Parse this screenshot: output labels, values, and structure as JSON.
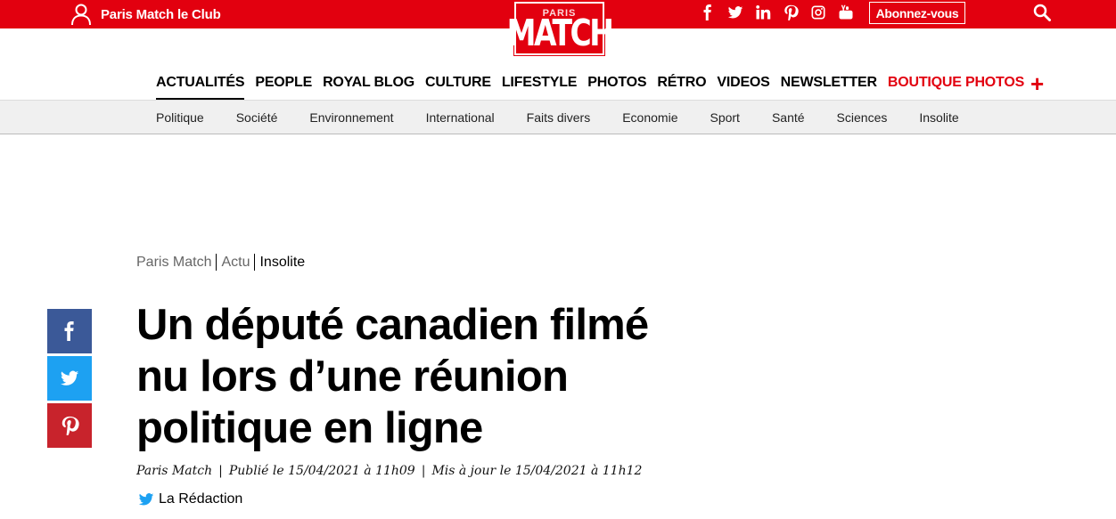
{
  "topbar": {
    "club_label": "Paris Match le Club",
    "logo_small": "PARIS",
    "logo_big": "MATCH",
    "subscribe_label": "Abonnez-vous",
    "social_icons": [
      "facebook-icon",
      "twitter-icon",
      "linkedin-icon",
      "pinterest-icon",
      "instagram-icon",
      "youtube-icon"
    ],
    "brand_color": "#e2000f"
  },
  "main_nav": {
    "items": [
      {
        "label": "ACTUALITÉS"
      },
      {
        "label": "PEOPLE"
      },
      {
        "label": "ROYAL BLOG"
      },
      {
        "label": "CULTURE"
      },
      {
        "label": "LIFESTYLE"
      },
      {
        "label": "PHOTOS"
      },
      {
        "label": "RÉTRO"
      },
      {
        "label": "VIDEOS"
      },
      {
        "label": "NEWSLETTER"
      },
      {
        "label": "BOUTIQUE PHOTOS"
      }
    ],
    "more_label": "+"
  },
  "sub_nav": {
    "items": [
      {
        "label": "Politique"
      },
      {
        "label": "Société"
      },
      {
        "label": "Environnement"
      },
      {
        "label": "International"
      },
      {
        "label": "Faits divers"
      },
      {
        "label": "Economie"
      },
      {
        "label": "Sport"
      },
      {
        "label": "Santé"
      },
      {
        "label": "Sciences"
      },
      {
        "label": "Insolite"
      }
    ]
  },
  "breadcrumb": [
    "Paris Match",
    "Actu",
    "Insolite"
  ],
  "article": {
    "title_lines": [
      "Un député canadien filmé",
      "nu lors d’une réunion",
      "politique en ligne"
    ],
    "source": "Paris Match",
    "published": "Publié le 15/04/2021 à 11h09",
    "updated": "Mis à jour le 15/04/2021 à 11h12",
    "author": "La Rédaction"
  }
}
